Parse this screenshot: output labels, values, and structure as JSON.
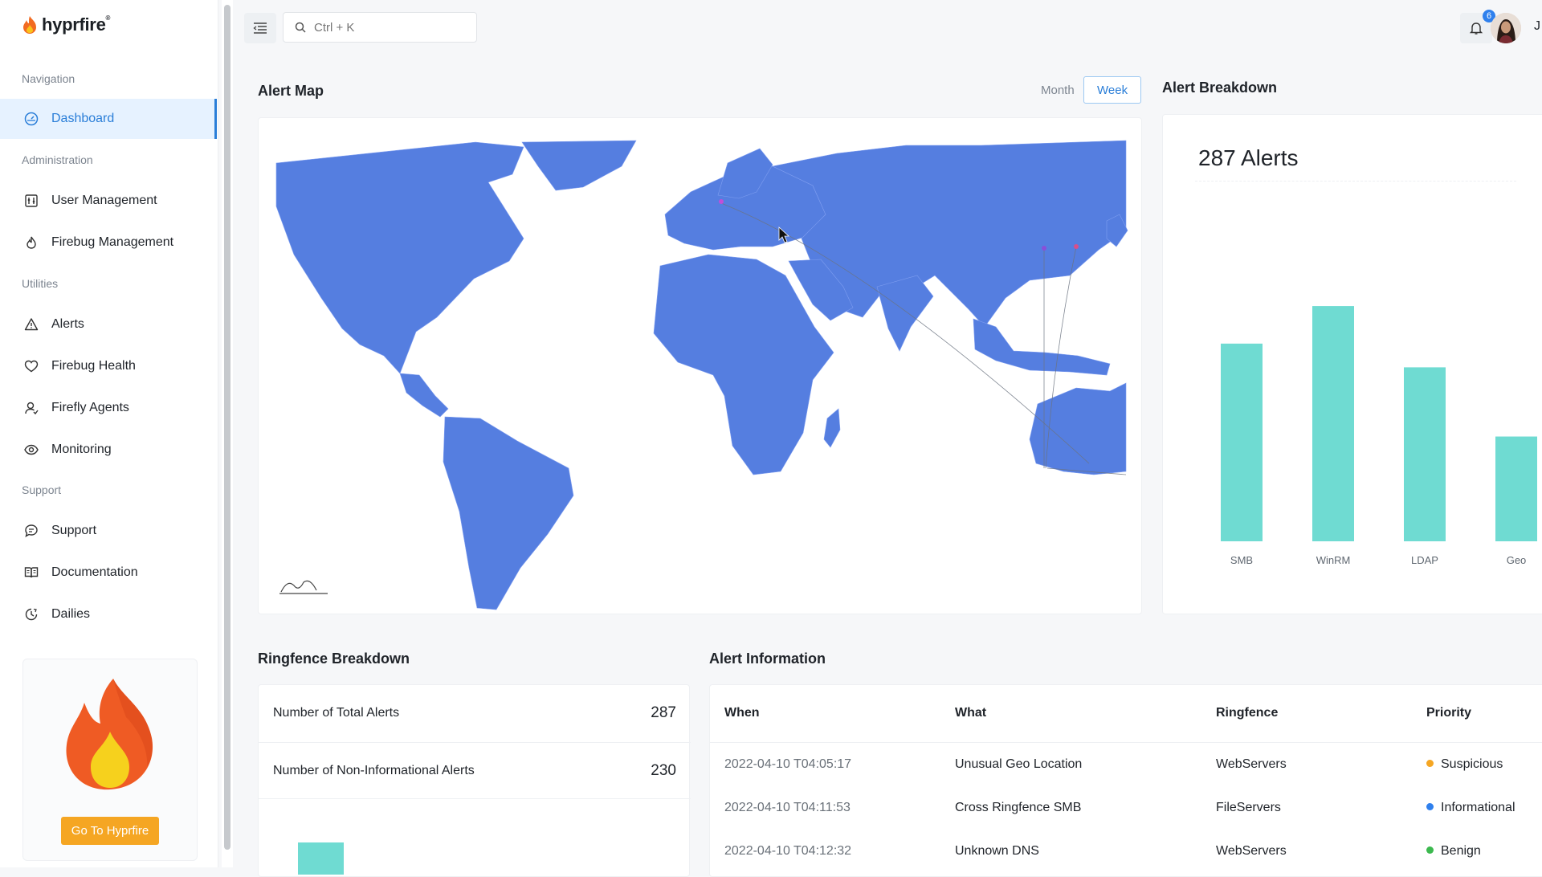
{
  "brand": {
    "name": "hyprfire",
    "mark": "®"
  },
  "sidebar": {
    "sections": {
      "navigation": "Navigation",
      "administration": "Administration",
      "utilities": "Utilities",
      "support": "Support"
    },
    "items": [
      {
        "label": "Dashboard",
        "icon": "dashboard-icon"
      },
      {
        "label": "User Management",
        "icon": "user-management-icon"
      },
      {
        "label": "Firebug Management",
        "icon": "flame-icon"
      },
      {
        "label": "Alerts",
        "icon": "warning-icon"
      },
      {
        "label": "Firebug Health",
        "icon": "heart-icon"
      },
      {
        "label": "Firefly Agents",
        "icon": "agent-icon"
      },
      {
        "label": "Monitoring",
        "icon": "eye-icon"
      },
      {
        "label": "Support",
        "icon": "chat-icon"
      },
      {
        "label": "Documentation",
        "icon": "book-icon"
      },
      {
        "label": "Dailies",
        "icon": "clock-icon"
      }
    ],
    "promo_button": "Go To Hyprfire"
  },
  "topbar": {
    "search_placeholder": "Ctrl + K",
    "notification_count": "6",
    "user_initial_cut": "J"
  },
  "alert_map": {
    "title": "Alert Map",
    "tab_month": "Month",
    "tab_week": "Week"
  },
  "alert_breakdown": {
    "title": "Alert Breakdown",
    "total_label": "287 Alerts",
    "chart_data": {
      "type": "bar",
      "categories": [
        "SMB",
        "WinRM",
        "LDAP",
        "Geo"
      ],
      "values": [
        100,
        119,
        88,
        53
      ],
      "ylim": [
        0,
        130
      ],
      "color": "#6fdbd2",
      "grid": false
    }
  },
  "ringfence": {
    "title": "Ringfence Breakdown",
    "rows": [
      {
        "label": "Number of Total Alerts",
        "value": "287"
      },
      {
        "label": "Number of Non-Informational Alerts",
        "value": "230"
      }
    ]
  },
  "alert_info": {
    "title": "Alert Information",
    "columns": [
      "When",
      "What",
      "Ringfence",
      "Priority"
    ],
    "rows": [
      {
        "when": "2022-04-10 T04:05:17",
        "what": "Unusual Geo Location",
        "ringfence": "WebServers",
        "priority": "Suspicious",
        "priority_color": "#f5a623"
      },
      {
        "when": "2022-04-10 T04:11:53",
        "what": "Cross Ringfence SMB",
        "ringfence": "FileServers",
        "priority": "Informational",
        "priority_color": "#2f80ed"
      },
      {
        "when": "2022-04-10 T04:12:32",
        "what": "Unknown DNS",
        "ringfence": "WebServers",
        "priority": "Benign",
        "priority_color": "#3cb94f"
      }
    ]
  }
}
